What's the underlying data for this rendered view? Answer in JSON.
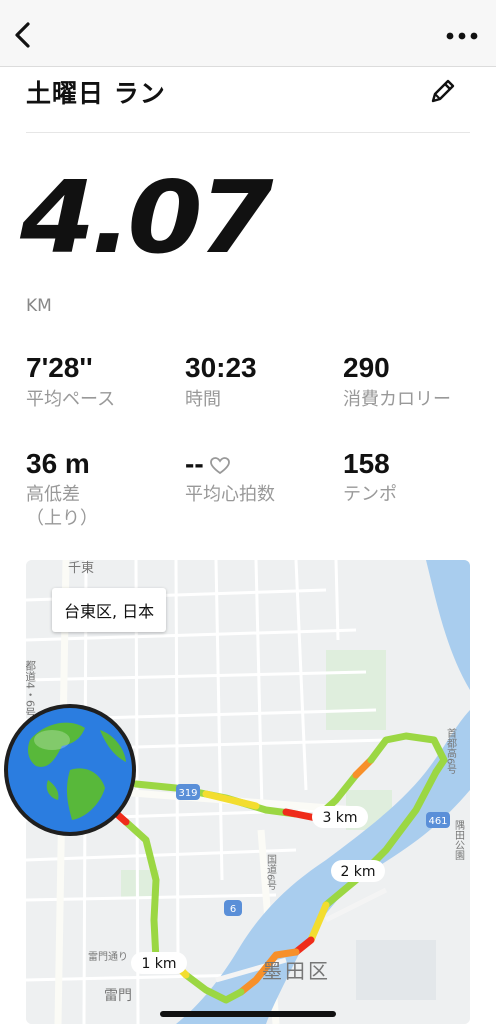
{
  "header": {
    "back_icon": "chevron-left-icon",
    "more_icon": "ellipsis-icon"
  },
  "activity": {
    "title": "土曜日 ラン",
    "edit_icon": "pencil-icon",
    "distance": "4.07",
    "distance_unit": "KM"
  },
  "stats": [
    {
      "value": "7'28''",
      "label": "平均ペース"
    },
    {
      "value": "30:23",
      "label": "時間"
    },
    {
      "value": "290",
      "label": "消費カロリー"
    },
    {
      "value": "36 m",
      "label": "高低差",
      "label2": "（上り）"
    },
    {
      "value": "--",
      "label": "平均心拍数"
    },
    {
      "value": "158",
      "label": "テンポ"
    }
  ],
  "map": {
    "location": "台東区, 日本",
    "km_markers": [
      "1 km",
      "2 km",
      "3 km"
    ],
    "labels": {
      "ward": "墨田区",
      "area_top": "千東",
      "area_bottom": "雷門",
      "street_bottom": "雷門通り",
      "route_319": "319",
      "route_6": "6",
      "route_461": "461",
      "vertical_road": "都道4・6号",
      "river_road": "首都高6号",
      "road_9": "9号",
      "vertical_right": "隅田公園",
      "vertical_mid": "国道6号"
    },
    "route_colors": {
      "green": "#9bd743",
      "yellow": "#f3dd2f",
      "orange": "#f7902a",
      "red": "#ef2c1b"
    },
    "water_color": "#a9cdee"
  }
}
